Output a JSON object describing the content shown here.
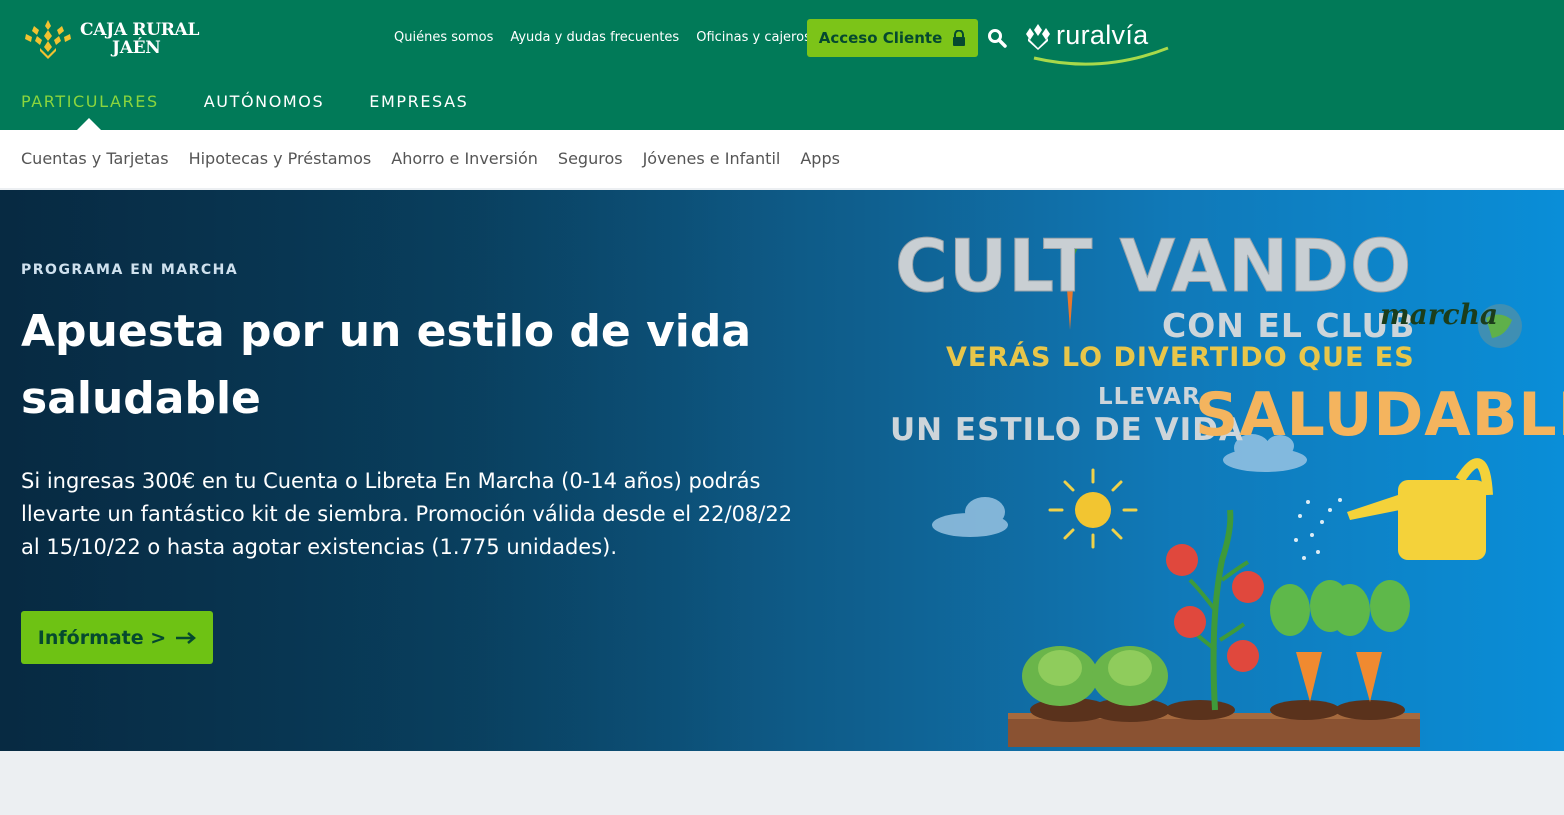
{
  "brand": {
    "line1": "CAJA RURAL",
    "line2": "JAÉN",
    "color": "#017a58",
    "accent": "#7cc418"
  },
  "top_links": [
    "Quiénes somos",
    "Ayuda y dudas frecuentes",
    "Oficinas y cajeros"
  ],
  "access_button": {
    "label": "Acceso Cliente",
    "icon": "lock-icon"
  },
  "search": {
    "icon": "search-icon"
  },
  "ruralvia": {
    "label": "ruralvía"
  },
  "main_nav": [
    {
      "label": "PARTICULARES",
      "active": true
    },
    {
      "label": "AUTÓNOMOS",
      "active": false
    },
    {
      "label": "EMPRESAS",
      "active": false
    }
  ],
  "sub_nav": [
    "Cuentas y Tarjetas",
    "Hipotecas y Préstamos",
    "Ahorro e Inversión",
    "Seguros",
    "Jóvenes e Infantil",
    "Apps"
  ],
  "hero": {
    "eyebrow": "PROGRAMA EN MARCHA",
    "title": "Apuesta por un estilo de vida saludable",
    "text": "Si ingresas 300€ en tu Cuenta o Libreta En Marcha (0-14 años) podrás llevarte un fantástico kit de siembra. Promoción válida desde el 22/08/22 al 15/10/22 o hasta agotar existencias (1.775 unidades).",
    "button": "Infórmate >",
    "button_icon": "arrow-right-icon"
  },
  "art": {
    "title": "CULT VANDO",
    "line2": "CON EL CLUB",
    "club_name": "marcha",
    "line3": "VERÁS LO DIVERTIDO QUE ES",
    "line4": "LLEVAR",
    "line5": "UN ESTILO DE VIDA",
    "line6": "SALUDABLE"
  }
}
